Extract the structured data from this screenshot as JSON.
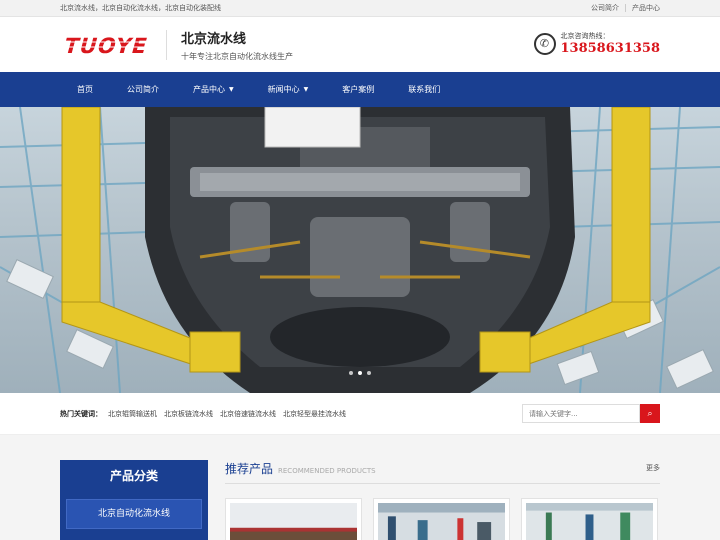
{
  "topbar": {
    "left_text": "北京流水线，北京自动化流水线，北京自动化装配线",
    "links": [
      "公司简介",
      "产品中心"
    ]
  },
  "header": {
    "logo_text": "TUOYE",
    "site_name": "北京流水线",
    "slogan": "十年专注北京自动化流水线生产",
    "hotline_label": "北京咨询热线：",
    "hotline_number": "13858631358"
  },
  "nav": {
    "items": [
      {
        "label": "首页",
        "dropdown": false
      },
      {
        "label": "公司简介",
        "dropdown": false
      },
      {
        "label": "产品中心",
        "dropdown": true
      },
      {
        "label": "新闻中心",
        "dropdown": true
      },
      {
        "label": "客户案例",
        "dropdown": false
      },
      {
        "label": "联系我们",
        "dropdown": false
      }
    ]
  },
  "banner": {
    "slide_count": 3,
    "active_index": 1
  },
  "hotwords": {
    "title": "热门关键词：",
    "items": [
      "北京辊筒输送机",
      "北京板链流水线",
      "北京倍速链流水线",
      "北京轻型悬挂流水线"
    ]
  },
  "search": {
    "placeholder": "请输入关键字..."
  },
  "sidebar": {
    "title": "产品分类",
    "items": [
      "北京自动化流水线"
    ]
  },
  "products": {
    "title": "推荐产品",
    "subtitle": "RECOMMENDED PRODUCTS",
    "more": "更多"
  },
  "colors": {
    "brand_blue": "#1a3f91",
    "accent_red": "#d9161c"
  }
}
